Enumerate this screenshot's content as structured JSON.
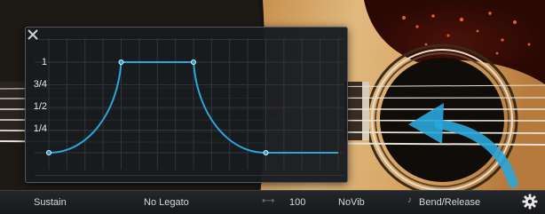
{
  "editor": {
    "y_ticks": [
      "1",
      "3/4",
      "1/2",
      "1/4"
    ],
    "close_icon": "close-icon",
    "accent_color": "#2aa6da"
  },
  "chart_data": {
    "type": "line",
    "y_ticks": [
      "1",
      "3/4",
      "1/2",
      "1/4"
    ],
    "ylim": [
      0,
      1
    ],
    "xlim": [
      0,
      1
    ],
    "grid": true,
    "series": [
      {
        "points": [
          [
            0,
            0
          ],
          [
            0.25,
            1
          ],
          [
            0.5,
            1
          ],
          [
            0.75,
            0
          ],
          [
            1,
            0
          ]
        ],
        "color": "#2aa6da"
      }
    ]
  },
  "bottom_bar": {
    "sustain": "Sustain",
    "legato": "No Legato",
    "value": "100",
    "vibrato": "NoVib",
    "bend": "Bend/Release",
    "note_icon": "note-icon",
    "link_icon": "link-icon",
    "settings_icon": "gear-icon"
  }
}
